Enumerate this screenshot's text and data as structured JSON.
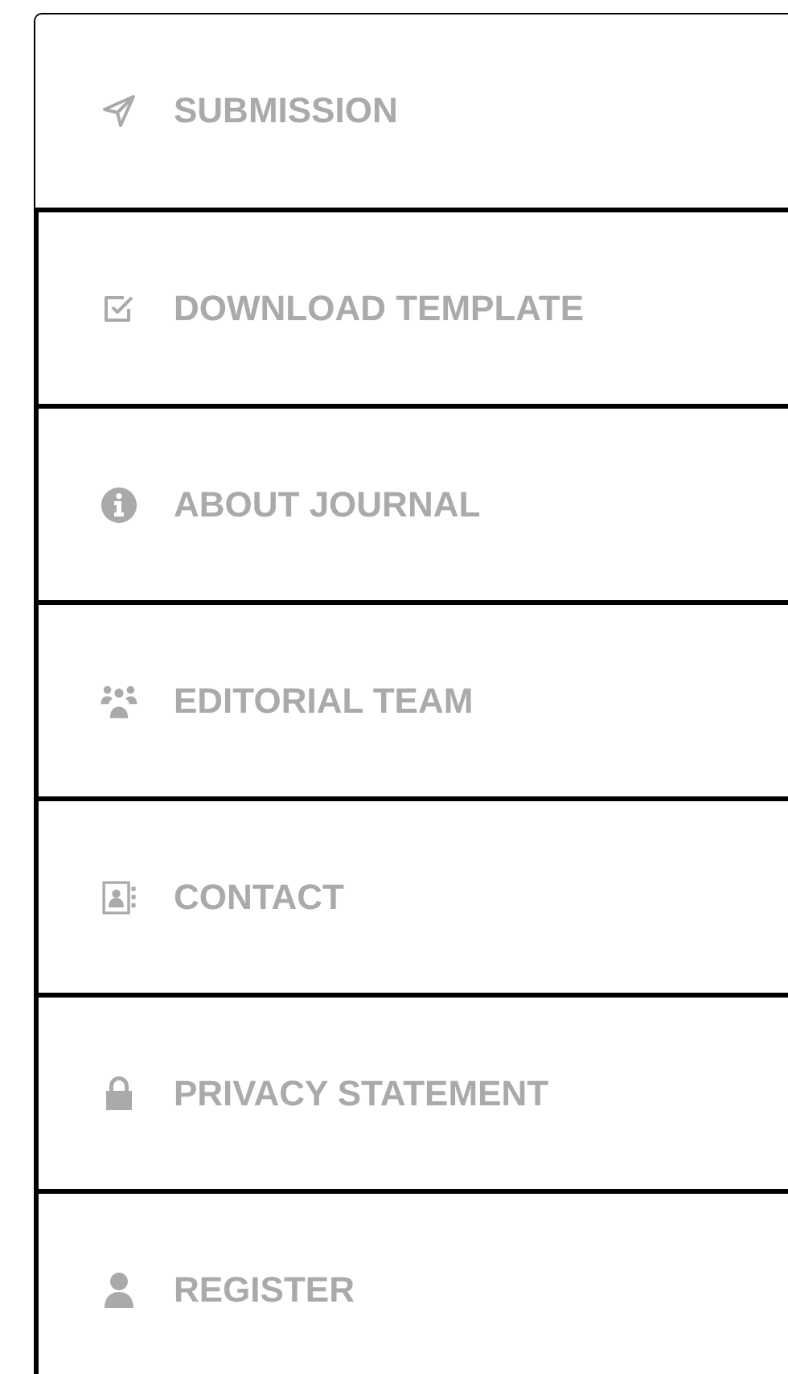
{
  "menu": [
    {
      "label": "SUBMISSION"
    },
    {
      "label": "DOWNLOAD TEMPLATE"
    },
    {
      "label": "ABOUT JOURNAL"
    },
    {
      "label": "EDITORIAL TEAM"
    },
    {
      "label": "CONTACT"
    },
    {
      "label": "PRIVACY STATEMENT"
    },
    {
      "label": "REGISTER"
    }
  ]
}
